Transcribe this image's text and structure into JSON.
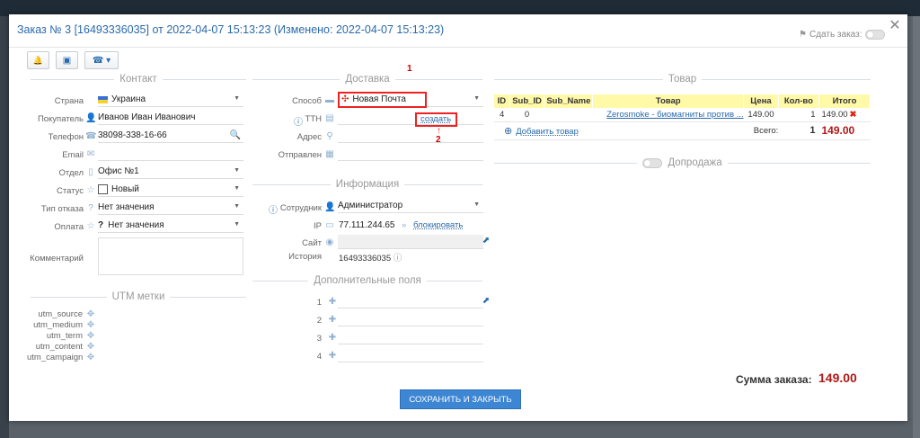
{
  "modal": {
    "title": "Заказ № 3 [16493336035] от 2022-04-07 15:13:23 (Изменено: 2022-04-07 15:13:23)",
    "sdat_label": "Сдать заказ:",
    "close_glyph": "✕"
  },
  "toolbar": {
    "bell": "🔔",
    "window": "▣",
    "phone": "☎",
    "dropdown": "▾"
  },
  "contact": {
    "title": "Контакт",
    "country_label": "Страна",
    "country_value": "Украина",
    "buyer_label": "Покупатель",
    "buyer_value": "Иванов Иван Иванович",
    "phone_label": "Телефон",
    "phone_value": "38098-338-16-66",
    "email_label": "Email",
    "email_value": "",
    "dept_label": "Отдел",
    "dept_value": "Офис №1",
    "status_label": "Статус",
    "status_value": "Новый",
    "refuse_label": "Тип отказа",
    "refuse_value": "Нет значения",
    "pay_label": "Оплата",
    "pay_value": "Нет значения",
    "comment_label": "Комментарий"
  },
  "utm": {
    "title": "UTM метки",
    "items": [
      "utm_source",
      "utm_medium",
      "utm_term",
      "utm_content",
      "utm_campaign"
    ]
  },
  "delivery": {
    "title": "Доставка",
    "method_label": "Способ",
    "method_value": "Новая Почта",
    "ttn_label": "ТТН",
    "ttn_link": "создать",
    "address_label": "Адрес",
    "sent_label": "Отправлен",
    "marker1": "1",
    "marker2": "2"
  },
  "info": {
    "title": "Информация",
    "employee_label": "Сотрудник",
    "employee_value": "Администратор",
    "ip_label": "IP",
    "ip_value": "77.111.244.65",
    "block_link": "блокировать",
    "site_label": "Сайт",
    "history_label": "История",
    "history_value": "16493336035"
  },
  "extra": {
    "title": "Дополнительные поля",
    "rows": [
      "1",
      "2",
      "3",
      "4"
    ]
  },
  "goods": {
    "title": "Товар",
    "columns": [
      "ID",
      "Sub_ID",
      "Sub_Name",
      "Товар",
      "Цена",
      "Кол-во",
      "Итого"
    ],
    "row": {
      "id": "4",
      "sub_id": "0",
      "sub_name": "",
      "product": "Zerosmoke - биомагниты против ...",
      "price": "149.00",
      "qty": "1",
      "total": "149.00"
    },
    "add_link": "Добавить товар",
    "total_label": "Всего:",
    "total_qty": "1",
    "total_sum": "149.00"
  },
  "upsell": {
    "title": "Допродажа"
  },
  "footer": {
    "save_label": "СОХРАНИТЬ И ЗАКРЫТЬ",
    "sum_label": "Сумма заказа:",
    "sum_value": "149.00"
  },
  "colors": {
    "accent": "#2a6aab",
    "highlight": "#fff9a8",
    "total_red": "#b01818",
    "marker_red": "#e22222"
  }
}
